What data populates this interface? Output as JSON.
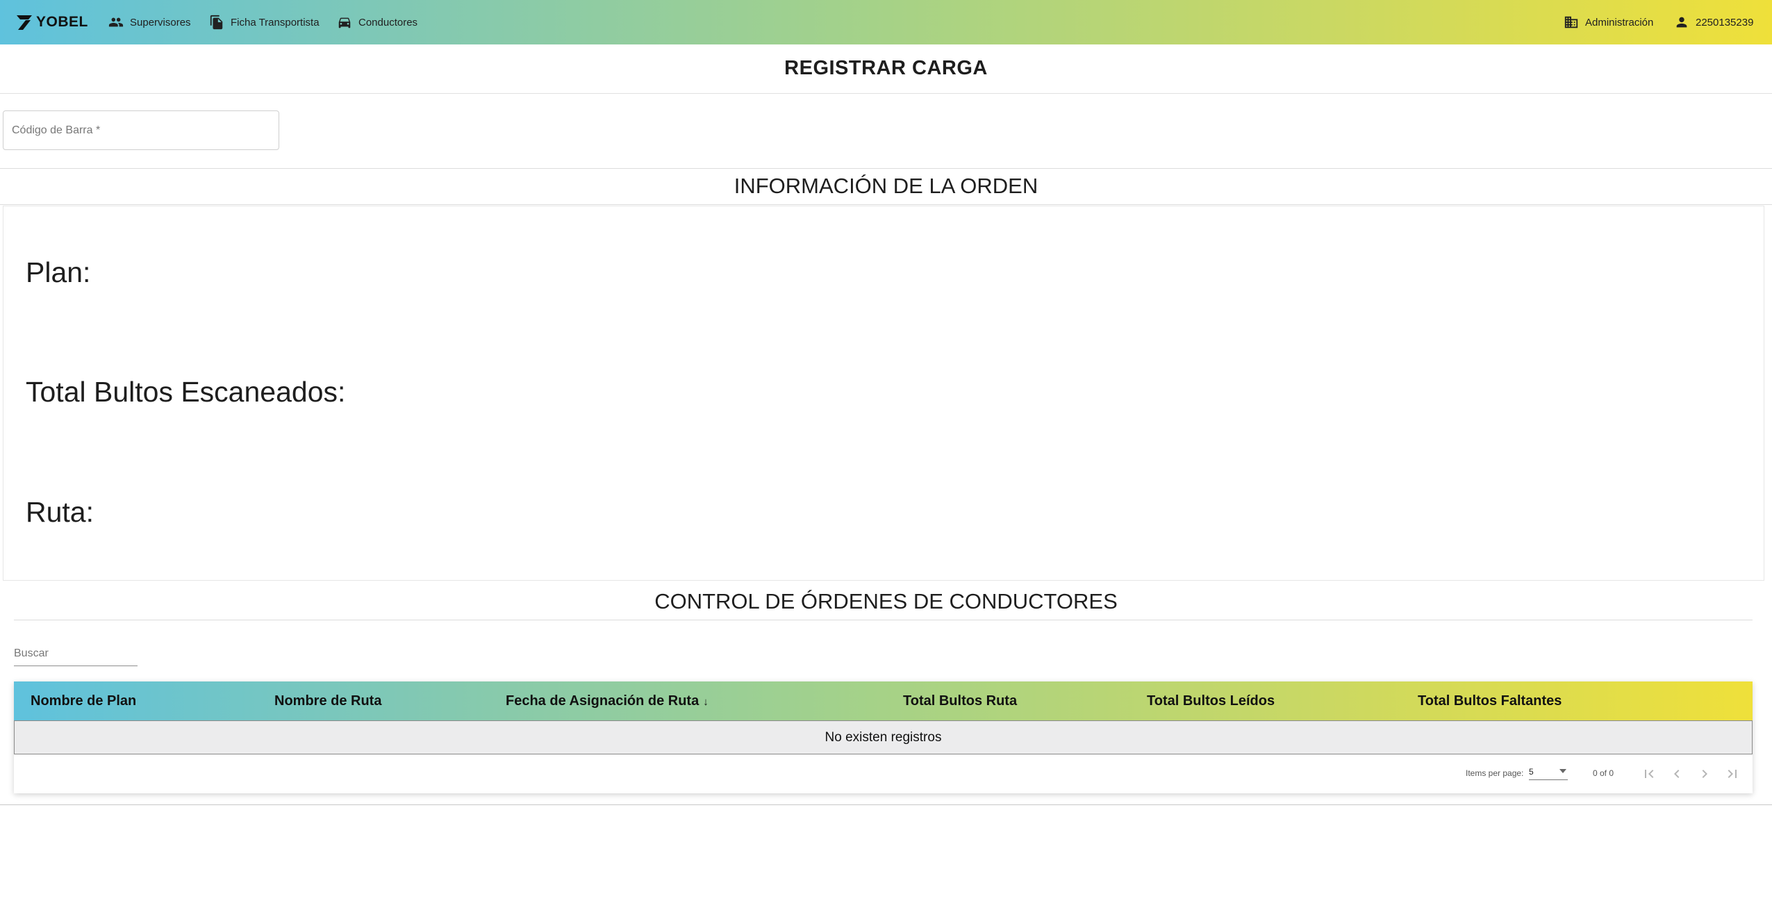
{
  "brand": {
    "name": "YOBEL"
  },
  "nav": {
    "items": [
      {
        "label": "Supervisores",
        "icon": "group-icon"
      },
      {
        "label": "Ficha Transportista",
        "icon": "file-copy-icon"
      },
      {
        "label": "Conductores",
        "icon": "car-icon"
      }
    ],
    "right": [
      {
        "label": "Administración",
        "icon": "building-icon"
      },
      {
        "label": "2250135239",
        "icon": "person-icon"
      }
    ]
  },
  "page": {
    "title": "REGISTRAR CARGA"
  },
  "barcode": {
    "placeholder": "Código de Barra *",
    "value": ""
  },
  "order_info": {
    "title": "INFORMACIÓN DE LA ORDEN",
    "plan_label": "Plan:",
    "bultos_label": "Total Bultos Escaneados:",
    "ruta_label": "Ruta:"
  },
  "control": {
    "title": "CONTROL DE ÓRDENES DE CONDUCTORES",
    "search_placeholder": "Buscar",
    "columns": [
      "Nombre de Plan",
      "Nombre de Ruta",
      "Fecha de Asignación de Ruta",
      "Total Bultos Ruta",
      "Total Bultos Leídos",
      "Total Bultos Faltantes"
    ],
    "sort_indicator": "↓",
    "empty_message": "No existen registros",
    "rows": []
  },
  "paginator": {
    "items_per_page_label": "Items per page:",
    "page_size": "5",
    "range_label": "0 of 0"
  },
  "colors": {
    "gradient_start": "#5fc2dd",
    "gradient_end": "#efe03a",
    "empty_row_bg": "#ececed"
  }
}
